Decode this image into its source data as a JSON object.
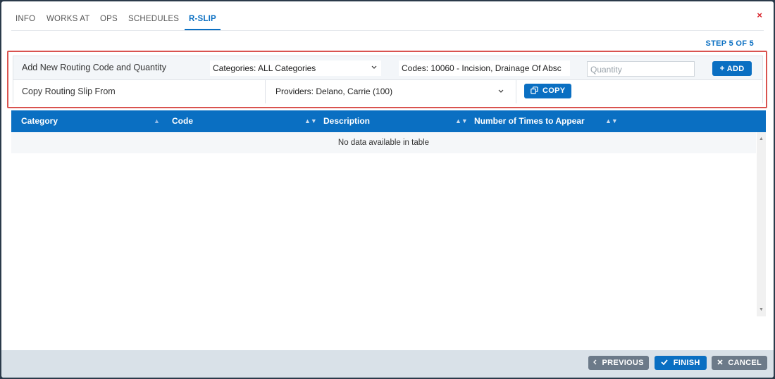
{
  "tabs": [
    "INFO",
    "WORKS AT",
    "OPS",
    "SCHEDULES",
    "R-SLIP"
  ],
  "active_tab": "R-SLIP",
  "close_glyph": "×",
  "step_label": "STEP 5 OF 5",
  "routing": {
    "label": "Add New Routing Code and Quantity",
    "category_select": "Categories: ALL Categories",
    "code_select": "Codes: 10060 - Incision, Drainage Of Absc",
    "quantity_placeholder": "Quantity",
    "add_button": "ADD"
  },
  "copy": {
    "label": "Copy Routing Slip From",
    "provider_select": "Providers: Delano, Carrie (100)",
    "copy_button": "COPY"
  },
  "table": {
    "columns": [
      "Category",
      "Code",
      "Description",
      "Number of Times to Appear"
    ],
    "empty_message": "No data available in table"
  },
  "footer": {
    "previous_button": "PREVIOUS",
    "finish_button": "FINISH",
    "cancel_button": "CANCEL"
  },
  "icons": {
    "add": "plus-icon",
    "copy": "copy-icon",
    "previous": "chevron-left-icon",
    "finish": "check-icon",
    "cancel": "x-icon"
  },
  "colors": {
    "accent": "#0a6fc2",
    "highlight_border": "#d9534f",
    "close": "#d9252c",
    "footer_grey_button": "#6c7a89"
  }
}
